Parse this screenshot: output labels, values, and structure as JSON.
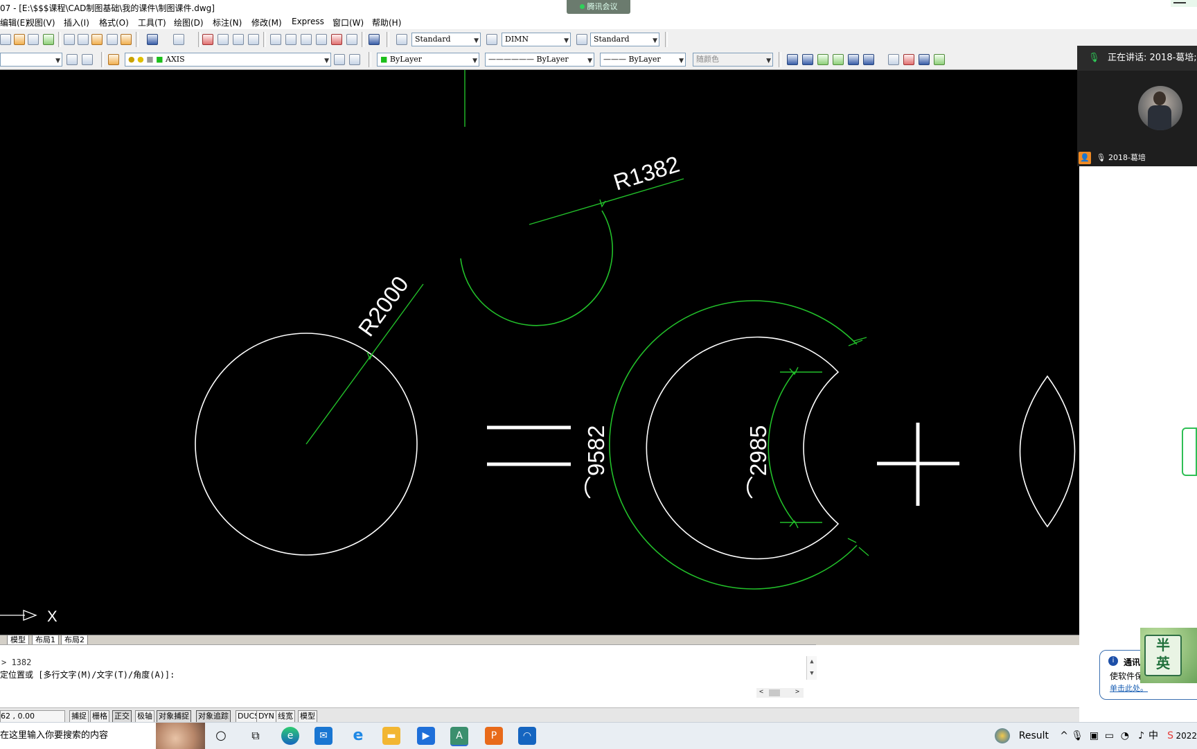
{
  "window": {
    "title": "07 - [E:\\$$$课程\\CAD制图基础\\我的课件\\制图课件.dwg]",
    "meeting_tag": "腾讯会议"
  },
  "menu": [
    "编辑(E)",
    "视图(V)",
    "插入(I)",
    "格式(O)",
    "工具(T)",
    "绘图(D)",
    "标注(N)",
    "修改(M)",
    "Express",
    "窗口(W)",
    "帮助(H)"
  ],
  "toolbar": {
    "text_style": "Standard",
    "dim_style": "DIMN",
    "table_style": "Standard",
    "layer": "AXIS",
    "color": "ByLayer",
    "linetype": "ByLayer",
    "lineweight": "ByLayer",
    "plot_style": "随颜色"
  },
  "drawing": {
    "dim_r2000": "R2000",
    "dim_r1382": "R1382",
    "dim_arc_outer": "⌒9582",
    "dim_arc_inner": "⌒2985",
    "ucs_x": "X",
    "colors": {
      "background": "#000000",
      "geometry": "#ffffff",
      "dimension": "#22c02a"
    }
  },
  "layout_tabs": [
    "模型",
    "布局1",
    "布局2"
  ],
  "command": {
    "line1": "> 1382",
    "line2": "定位置或 [多行文字(M)/文字(T)/角度(A)]:"
  },
  "status": {
    "coords": "62 , 0.00",
    "buttons": [
      "捕捉",
      "栅格",
      "正交",
      "极轴",
      "对象捕捉",
      "对象追踪",
      "DUCS",
      "DYN",
      "线宽",
      "模型"
    ]
  },
  "meeting": {
    "speaking": "正在讲话: 2018-葛培;",
    "participant": "2018-葛培"
  },
  "notification": {
    "title": "通讯",
    "body": "使软件保",
    "link": "单击此处。"
  },
  "ime": {
    "top": "半",
    "bottom": "英"
  },
  "taskbar": {
    "search_placeholder": "在这里输入你要搜索的内容",
    "weather": "Result",
    "tray_ime": "中",
    "clock": "2022"
  }
}
